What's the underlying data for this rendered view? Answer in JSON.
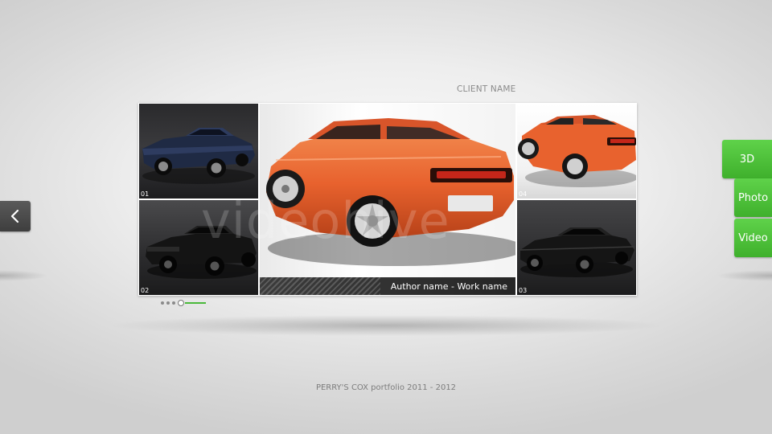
{
  "header": {
    "client_name": "CLIENT NAME"
  },
  "gallery": {
    "tiles": [
      {
        "number": "01"
      },
      {
        "number": "02"
      },
      {
        "number": "03"
      },
      {
        "number": "04"
      }
    ],
    "caption": "Author name  -  Work name",
    "watermark": "videohive"
  },
  "pager": {
    "dot_count": 4,
    "active_index": 3
  },
  "side_tabs": [
    {
      "label": "3D"
    },
    {
      "label": "Photo"
    },
    {
      "label": "Video"
    }
  ],
  "nav": {
    "prev_icon": "chevron-left-icon"
  },
  "footer": {
    "text": "PERRY'S COX portfolio  2011 - 2012"
  },
  "colors": {
    "accent_green": "#4ab93b",
    "car_orange": "#e8622e",
    "nav_gray": "#4a4a4a"
  }
}
